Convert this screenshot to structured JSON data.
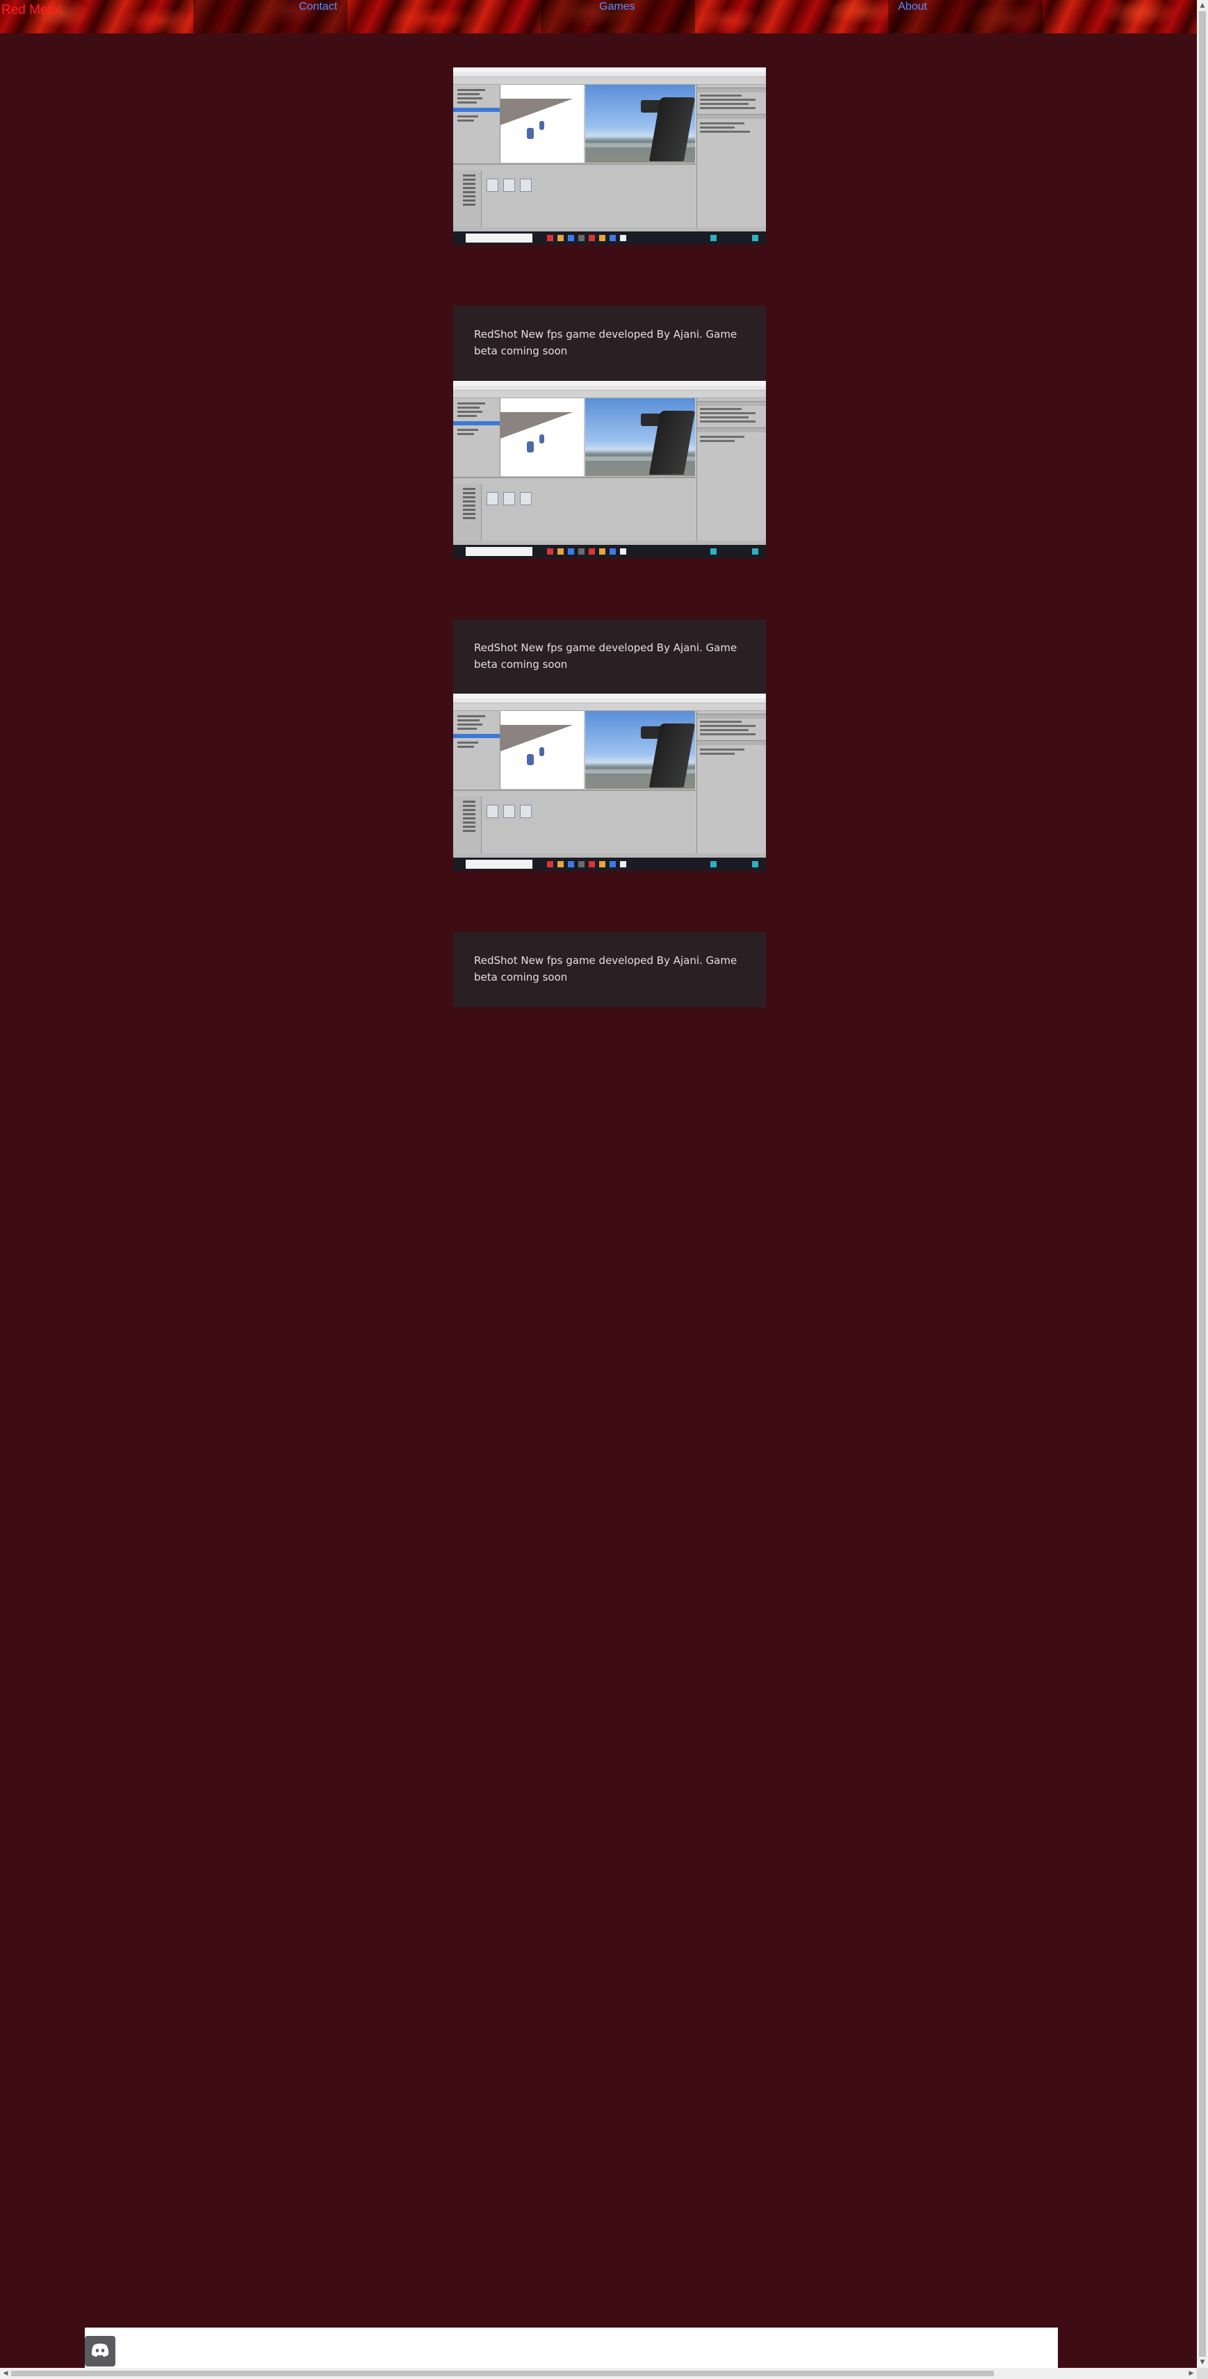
{
  "header": {
    "brand": "Red Metal",
    "nav": [
      {
        "label": "Contact"
      },
      {
        "label": "Games"
      },
      {
        "label": "About"
      }
    ]
  },
  "posts": [
    {
      "caption": "RedShot New fps game developed By Ajani. Game beta coming soon"
    },
    {
      "caption": "RedShot New fps game developed By Ajani. Game beta coming soon"
    },
    {
      "caption": "RedShot New fps game developed By Ajani. Game beta coming soon"
    }
  ],
  "footer": {
    "icon": "discord-icon"
  },
  "colors": {
    "page_bg": "#3d0d13",
    "caption_bg": "#2a1f22",
    "brand": "#ff2020",
    "nav_link": "#5e8dff"
  }
}
